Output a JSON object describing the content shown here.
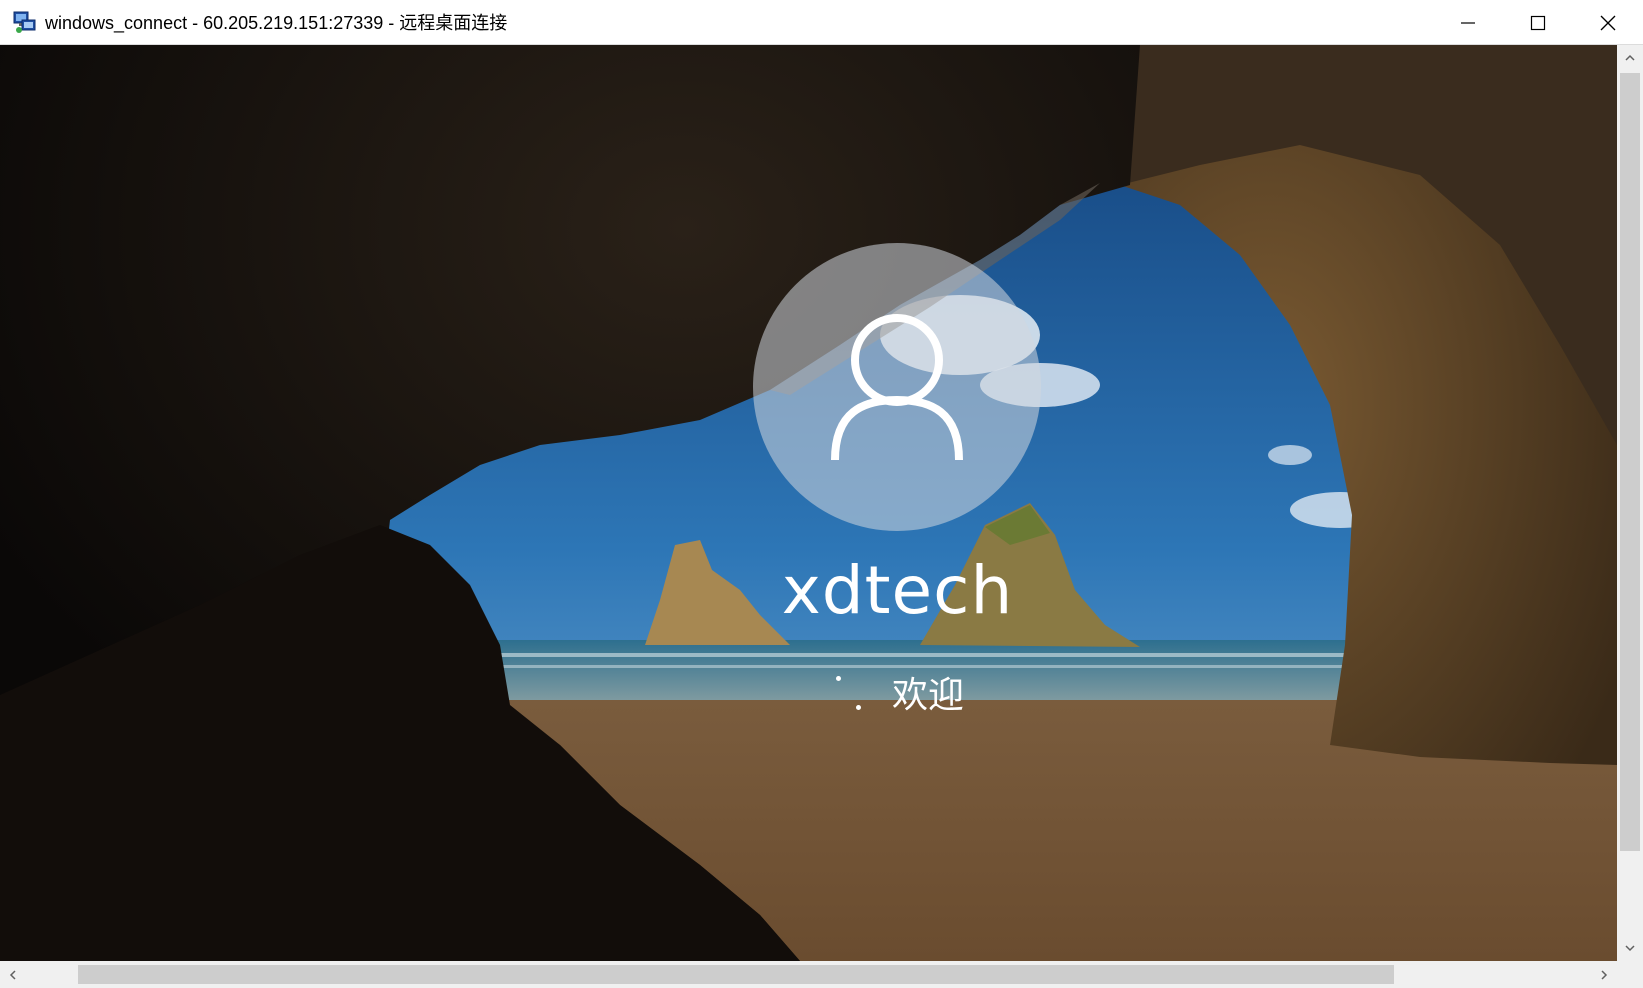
{
  "window": {
    "title": "windows_connect - 60.205.219.151:27339 - 远程桌面连接",
    "icon": "remote-desktop-icon",
    "controls": {
      "minimize": "minimize-icon",
      "maximize": "maximize-icon",
      "close": "close-icon"
    }
  },
  "login_screen": {
    "avatar_icon": "user-icon",
    "username": "xdtech",
    "status_text": "欢迎",
    "spinner_icon": "loading-spinner-icon"
  },
  "scrollbars": {
    "vertical": {
      "up": "chevron-up-icon",
      "down": "chevron-down-icon"
    },
    "horizontal": {
      "left": "chevron-left-icon",
      "right": "chevron-right-icon"
    }
  },
  "colors": {
    "sky": "#2a6fae",
    "sand": "#8a6a45",
    "cave": "#0a0807",
    "text": "#ffffff"
  }
}
